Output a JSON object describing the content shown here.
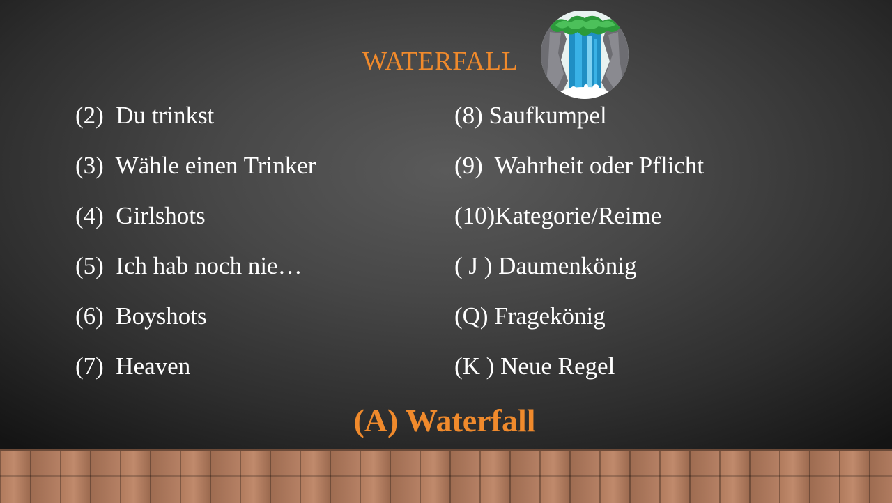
{
  "title": "WATERFALL",
  "left_items": [
    "(2)  Du trinkst",
    "(3)  Wähle einen Trinker",
    "(4)  Girlshots",
    "(5)  Ich hab noch nie…",
    "(6)  Boyshots",
    "(7)  Heaven"
  ],
  "right_items": [
    "(8) Saufkumpel",
    "(9)  Wahrheit oder Pflicht",
    "(10)Kategorie/Reime",
    "( J ) Daumenkönig",
    "(Q) Fragekönig",
    "(K ) Neue Regel"
  ],
  "footer": "(A) Waterfall",
  "icon": "waterfall-icon",
  "colors": {
    "accent": "#f08a2c",
    "text": "#ffffff",
    "background": "#474747",
    "floor": "#b07a5c"
  }
}
